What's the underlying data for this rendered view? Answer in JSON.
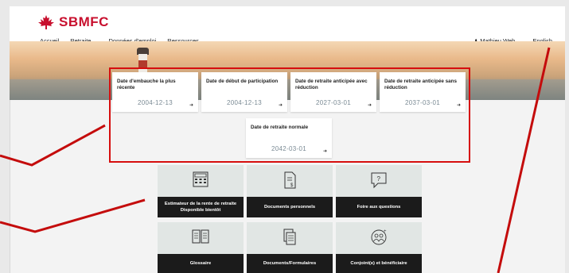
{
  "brand": {
    "name": "SBMFC",
    "color": "#c8102e"
  },
  "nav": {
    "items": [
      {
        "label": "Accueil",
        "dropdown": false
      },
      {
        "label": "Retraite",
        "dropdown": true
      },
      {
        "label": "Données d'emploi",
        "dropdown": false
      },
      {
        "label": "Ressources",
        "dropdown": true
      }
    ],
    "user": {
      "label": "Mathieu Web",
      "icon": "user-icon"
    },
    "language": "English"
  },
  "cards": [
    {
      "title": "Date d'embauche la plus récente",
      "date": "2004-12-13"
    },
    {
      "title": "Date de début de participation",
      "date": "2004-12-13"
    },
    {
      "title": "Date de retraite anticipée avec réduction",
      "date": "2027-03-01"
    },
    {
      "title": "Date de retraite anticipée sans réduction",
      "date": "2037-03-01"
    },
    {
      "title": "Date de retraite normale",
      "date": "2042-03-01"
    }
  ],
  "tiles": [
    {
      "label": "Estimateur de la rente de retraite",
      "sublabel": "Disponible bientôt",
      "icon": "calculator-icon"
    },
    {
      "label": "Documents personnels",
      "sublabel": "",
      "icon": "document-dollar-icon"
    },
    {
      "label": "Foire aux questions",
      "sublabel": "",
      "icon": "question-bubble-icon"
    },
    {
      "label": "Glossaire",
      "sublabel": "",
      "icon": "book-icon"
    },
    {
      "label": "Documents/Formulaires",
      "sublabel": "",
      "icon": "documents-icon"
    },
    {
      "label": "Conjoint(e) et bénéficiaire",
      "sublabel": "",
      "icon": "people-icon"
    }
  ],
  "colors": {
    "annotation": "#d60e0e",
    "tile_bg": "#e1e6e4",
    "tile_label_bg": "#1b1b1b",
    "date_text": "#7a8a94"
  }
}
